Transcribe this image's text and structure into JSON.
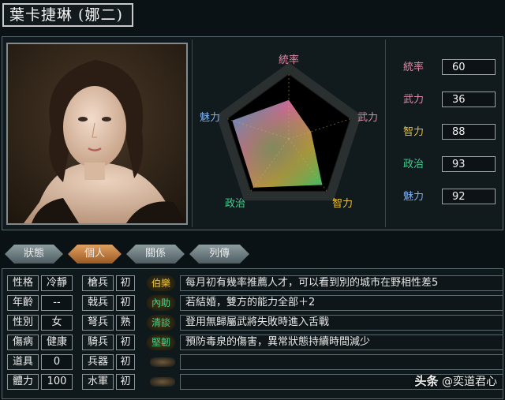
{
  "header": {
    "title": "葉卡捷琳 (娜二)"
  },
  "portrait": {
    "alt": "portrait"
  },
  "radar": {
    "labels": [
      "統率",
      "武力",
      "智力",
      "政治",
      "魅力"
    ],
    "label_colors": [
      "#e58aa6",
      "#e58aa6",
      "#e8c23a",
      "#3fcf8f",
      "#7fb1f0"
    ],
    "values": [
      60,
      36,
      88,
      93,
      92
    ]
  },
  "stats": [
    {
      "label": "統率",
      "value": "60",
      "color": "#e58aa6"
    },
    {
      "label": "武力",
      "value": "36",
      "color": "#e58aa6"
    },
    {
      "label": "智力",
      "value": "88",
      "color": "#e8c23a"
    },
    {
      "label": "政治",
      "value": "93",
      "color": "#3fcf8f"
    },
    {
      "label": "魅力",
      "value": "92",
      "color": "#7fb1f0"
    }
  ],
  "tabs": [
    {
      "label": "狀態",
      "active": false
    },
    {
      "label": "個人",
      "active": true
    },
    {
      "label": "關係",
      "active": false
    },
    {
      "label": "列傳",
      "active": false
    }
  ],
  "personal": [
    {
      "label": "性格",
      "value": "冷靜"
    },
    {
      "label": "年齡",
      "value": "--"
    },
    {
      "label": "性別",
      "value": "女"
    },
    {
      "label": "傷病",
      "value": "健康"
    },
    {
      "label": "道具",
      "value": "0"
    },
    {
      "label": "體力",
      "value": "100"
    }
  ],
  "troops": [
    {
      "label": "槍兵",
      "value": "初"
    },
    {
      "label": "戟兵",
      "value": "初"
    },
    {
      "label": "弩兵",
      "value": "熟"
    },
    {
      "label": "騎兵",
      "value": "初"
    },
    {
      "label": "兵器",
      "value": "初"
    },
    {
      "label": "水軍",
      "value": "初"
    }
  ],
  "skills": [
    {
      "name": "伯樂",
      "color": "#e8c23a",
      "desc": "每月初有幾率推薦人才，可以看到別的城市在野相性差5"
    },
    {
      "name": "內助",
      "color": "#3fcf8f",
      "desc": "若結婚，雙方的能力全部＋2"
    },
    {
      "name": "清談",
      "color": "#3fcf8f",
      "desc": "登用無歸屬武將失敗時進入舌戰"
    },
    {
      "name": "堅韌",
      "color": "#3fcf8f",
      "desc": "預防毒泉的傷害，異常狀態持續時間減少"
    }
  ],
  "watermark": {
    "brand": "头条",
    "handle": "@奕道君心"
  }
}
